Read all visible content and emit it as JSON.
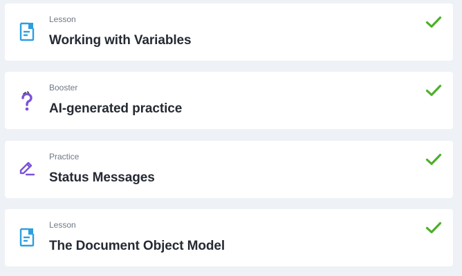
{
  "colors": {
    "background": "#eef1f5",
    "card": "#ffffff",
    "lesson_icon": "#2b9fe0",
    "booster_icon": "#7b52d6",
    "practice_icon": "#7b52d6",
    "check": "#4caf2a",
    "type_text": "#6f7784",
    "title_text": "#252a33"
  },
  "items": [
    {
      "type": "Lesson",
      "title": "Working with Variables",
      "icon": "document-icon",
      "completed": true
    },
    {
      "type": "Booster",
      "title": "AI-generated practice",
      "icon": "question-icon",
      "completed": true
    },
    {
      "type": "Practice",
      "title": "Status Messages",
      "icon": "pencil-icon",
      "completed": true
    },
    {
      "type": "Lesson",
      "title": "The Document Object Model",
      "icon": "document-icon",
      "completed": true
    }
  ]
}
